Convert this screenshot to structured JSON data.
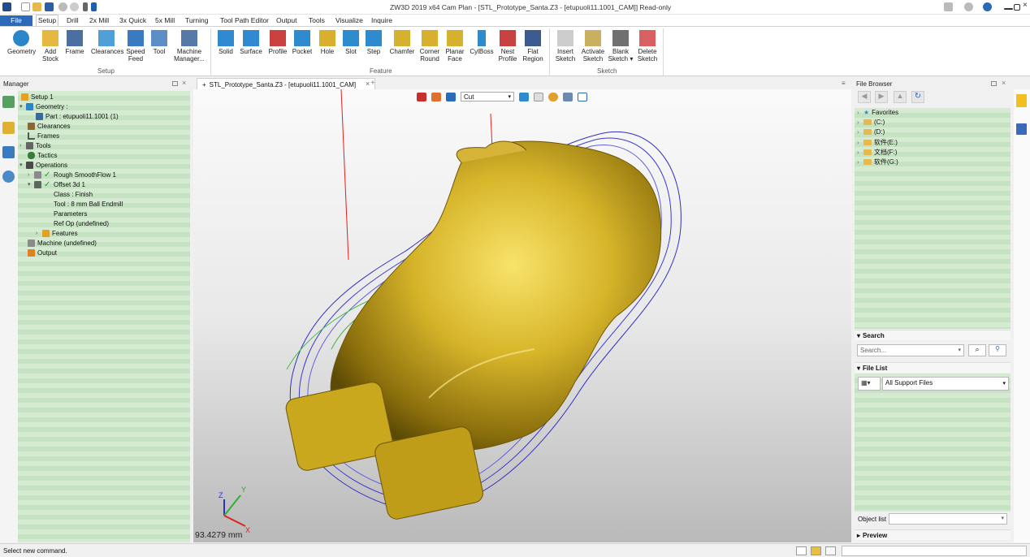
{
  "window": {
    "title": "ZW3D 2019  x64          Cam Plan - [STL_Prototype_Santa.Z3 - [etupuoli11.1001_CAM]] Read-only"
  },
  "menubar": [
    "File",
    "Setup",
    "Drill",
    "2x Mill",
    "3x Quick",
    "5x Mill",
    "Turning",
    "Tool Path Editor",
    "Output",
    "Tools",
    "Visualize",
    "Inquire"
  ],
  "ribbon": {
    "setup_group": "Setup",
    "feature_group": "Feature",
    "sketch_group": "Sketch",
    "setup_buttons": [
      "Geometry",
      "Add Stock",
      "Frame",
      "Clearances",
      "Speed Feed",
      "Tool",
      "Machine Manager..."
    ],
    "feature_buttons": [
      "Solid",
      "Surface",
      "Profile",
      "Pocket",
      "Hole",
      "Slot",
      "Step",
      "Chamfer",
      "Corner Round",
      "Planar Face",
      "CylBoss",
      "Nest Profile",
      "Flat Region"
    ],
    "sketch_buttons": [
      "Insert Sketch",
      "Activate Sketch",
      "Blank Sketch ▾",
      "Delete Sketch"
    ]
  },
  "manager": {
    "title": "Manager",
    "tree": [
      "Setup 1",
      "Geometry :",
      "Part : etupuoli11.1001 (1)",
      "Clearances",
      "Frames",
      "Tools",
      "Tactics",
      "Operations",
      "Rough SmoothFlow 1",
      "Offset 3d 1",
      "Class : Finish",
      "Tool : 8 mm Ball Endmill",
      "Parameters",
      "Ref Op (undefined)",
      "Features",
      "Machine (undefined)",
      "Output"
    ]
  },
  "document": {
    "tab": "STL_Prototype_Santa.Z3 - [etupuoli11.1001_CAM]",
    "cut_mode": "Cut",
    "scale": "93.4279 mm",
    "axes": {
      "x": "X",
      "y": "Y",
      "z": "Z"
    }
  },
  "file_browser": {
    "title": "File Browser",
    "items": [
      "Favorites",
      "(C:)",
      "(D:)",
      "软件(E:)",
      "文档(F:)",
      "软件(G:)"
    ],
    "search_label": "Search",
    "search_placeholder": "Search...",
    "file_list_label": "File List",
    "filter": "All Support Files",
    "object_list_label": "Object list",
    "preview_label": "Preview"
  },
  "status": {
    "message": "Select new command."
  },
  "colors": {
    "accent": "#2a6ab8",
    "tree_bg": "#cfe8cc",
    "model_gold": "#c9a81e"
  }
}
